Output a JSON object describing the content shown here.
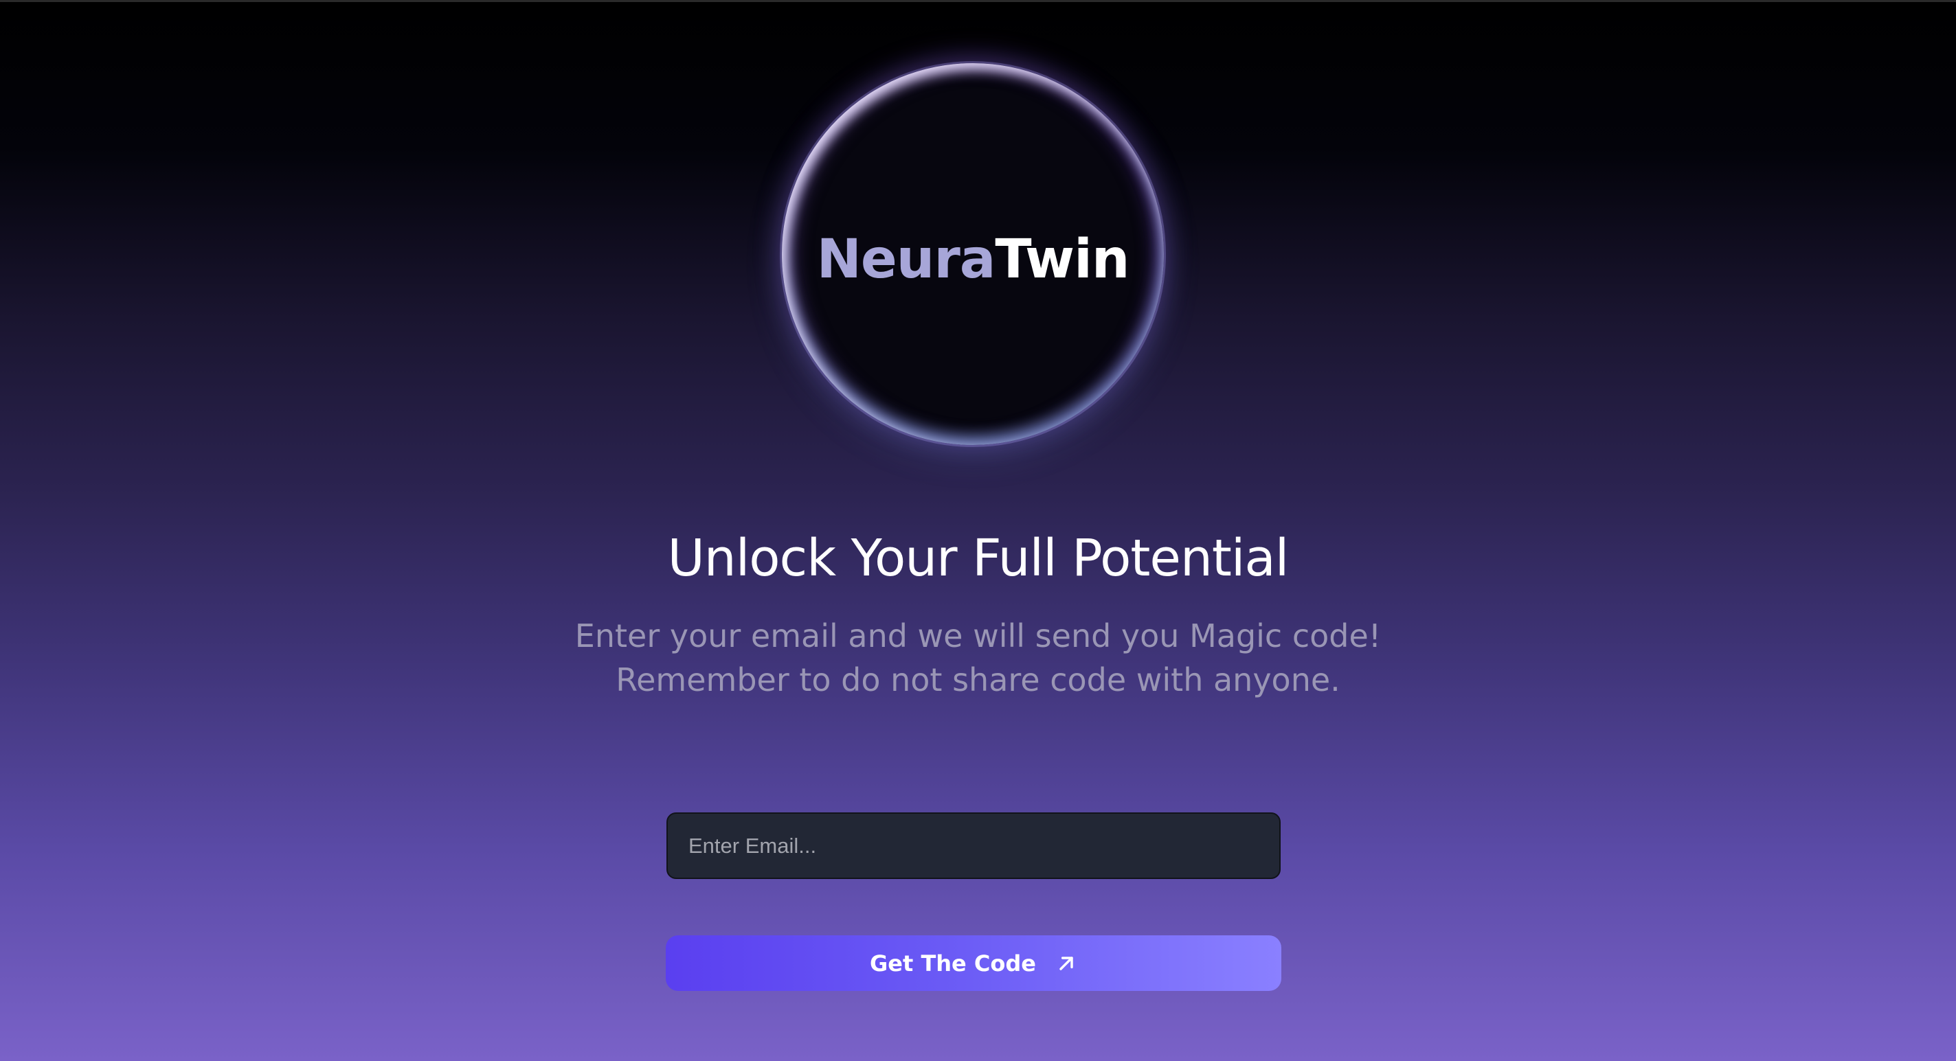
{
  "brand": {
    "name_part1": "Neura",
    "name_part2": "Twin"
  },
  "hero": {
    "headline": "Unlock Your Full Potential",
    "subline_1": "Enter your email and we will send you Magic code!",
    "subline_2": "Remember to do not share code with anyone."
  },
  "form": {
    "email_placeholder": "Enter Email...",
    "email_value": "",
    "submit_label": "Get The Code",
    "submit_icon": "arrow-up-right-icon"
  },
  "colors": {
    "accent_start": "#5a3ff0",
    "accent_end": "#8a80ff",
    "input_bg": "#222735",
    "background_top": "#000000",
    "background_bottom": "#7a62c8"
  }
}
